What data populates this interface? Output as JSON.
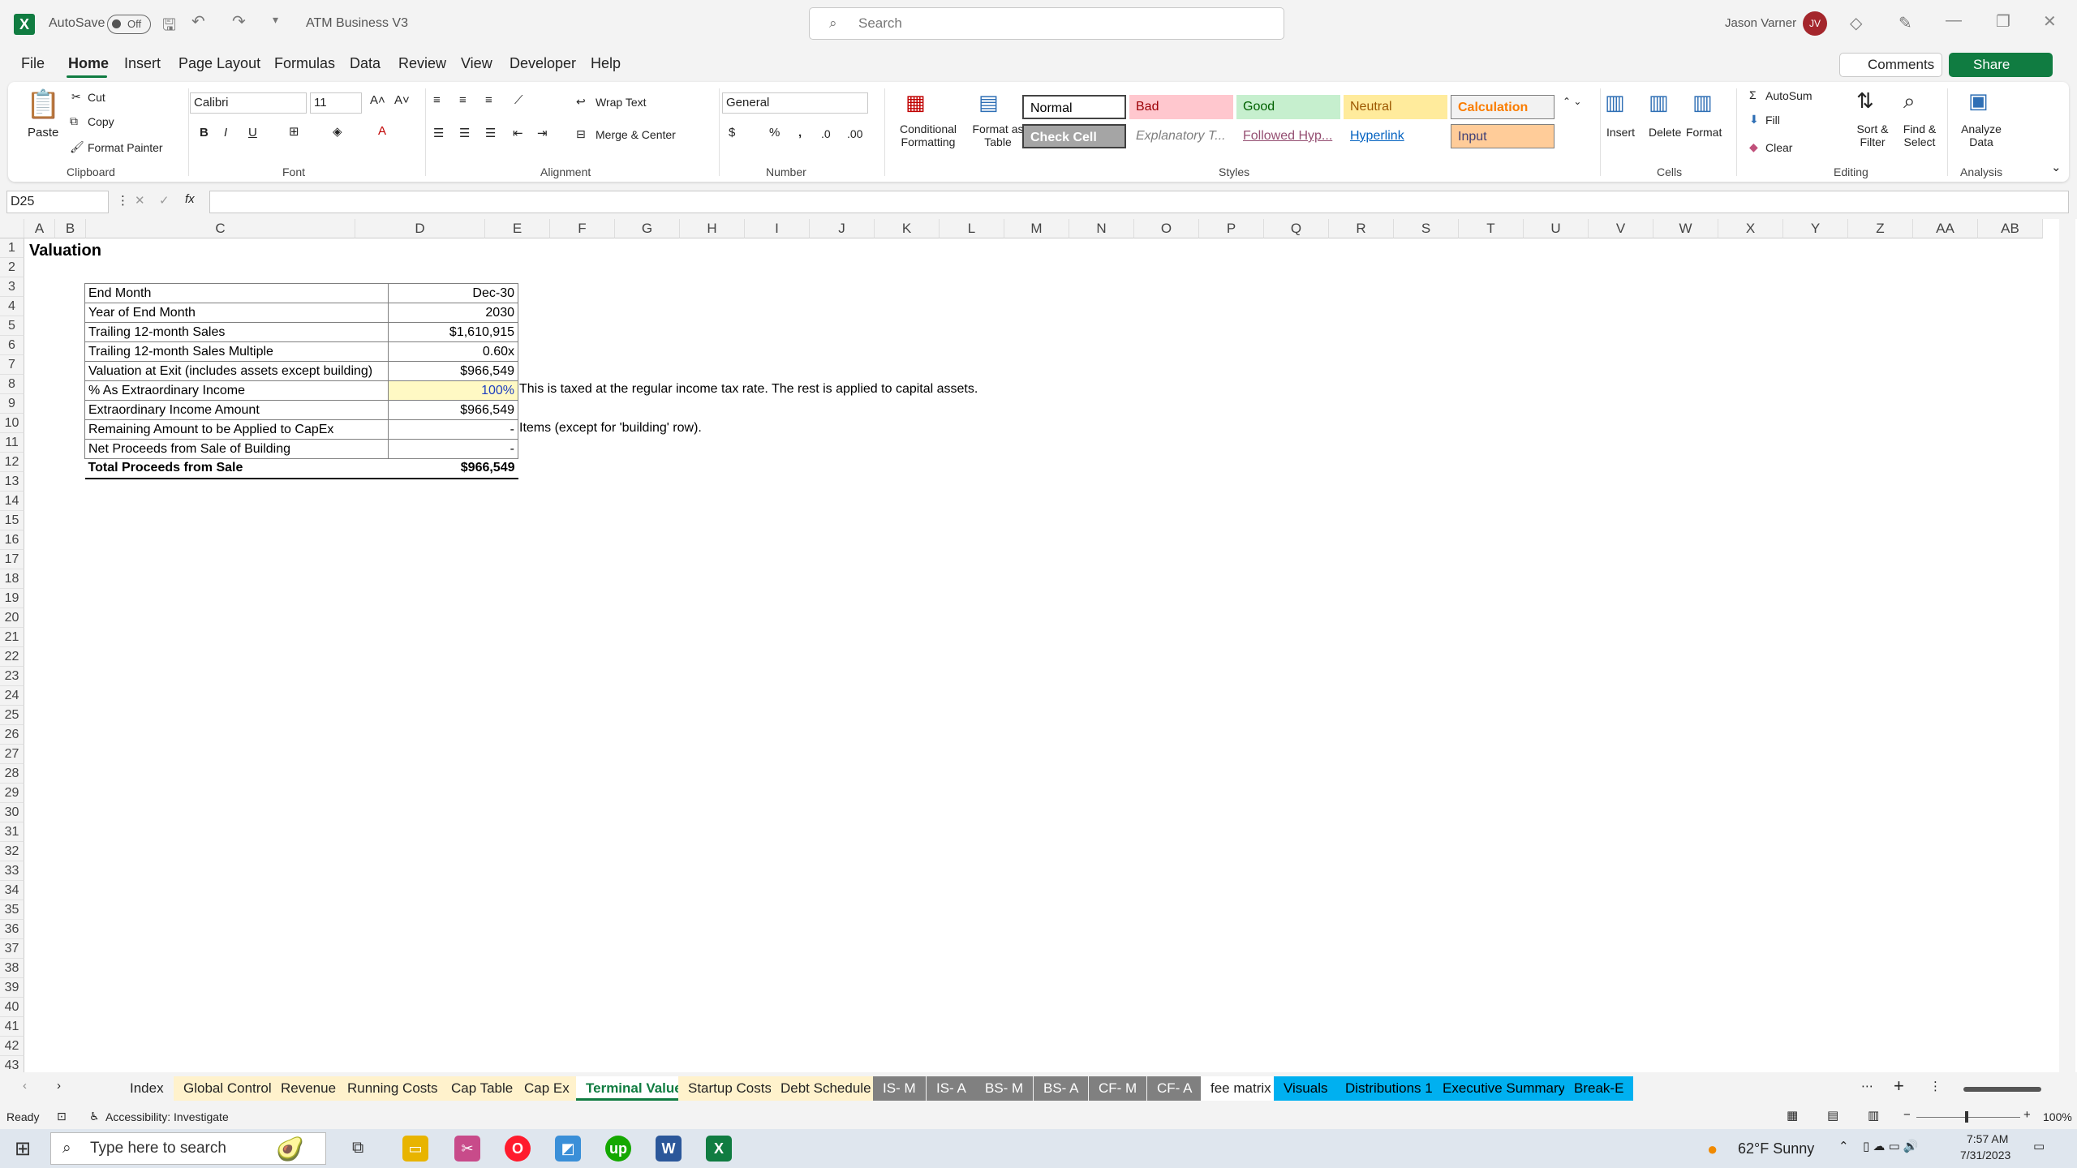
{
  "titlebar": {
    "autosave_label": "AutoSave",
    "autosave_state": "Off",
    "doc_title": "ATM Business V3",
    "search_placeholder": "Search",
    "user_name": "Jason Varner",
    "user_initials": "JV"
  },
  "menu": [
    "File",
    "Home",
    "Insert",
    "Page Layout",
    "Formulas",
    "Data",
    "Review",
    "View",
    "Developer",
    "Help"
  ],
  "buttons": {
    "comments": "Comments",
    "share": "Share"
  },
  "ribbon": {
    "clipboard": {
      "paste": "Paste",
      "cut": "Cut",
      "copy": "Copy",
      "format_painter": "Format Painter",
      "label": "Clipboard"
    },
    "font": {
      "name": "Calibri",
      "size": "11",
      "label": "Font"
    },
    "alignment": {
      "wrap": "Wrap Text",
      "merge": "Merge & Center",
      "label": "Alignment"
    },
    "number": {
      "format": "General",
      "label": "Number"
    },
    "styles": {
      "conditional": "Conditional Formatting",
      "format_table": "Format as Table",
      "cells": [
        {
          "name": "Normal",
          "bg": "#ffffff",
          "fg": "#000000"
        },
        {
          "name": "Bad",
          "bg": "#ffc7ce",
          "fg": "#9c0006"
        },
        {
          "name": "Good",
          "bg": "#c6efce",
          "fg": "#006100"
        },
        {
          "name": "Neutral",
          "bg": "#ffeb9c",
          "fg": "#9c5700"
        },
        {
          "name": "Calculation",
          "bg": "#f2f2f2",
          "fg": "#fa7d00"
        },
        {
          "name": "Check Cell",
          "bg": "#a5a5a5",
          "fg": "#ffffff"
        },
        {
          "name": "Explanatory T...",
          "bg": "#ffffff",
          "fg": "#7f7f7f"
        },
        {
          "name": "Followed Hyp...",
          "bg": "#ffffff",
          "fg": "#954f72"
        },
        {
          "name": "Hyperlink",
          "bg": "#ffffff",
          "fg": "#0563c1"
        },
        {
          "name": "Input",
          "bg": "#ffcc99",
          "fg": "#3f3f76"
        }
      ],
      "label": "Styles"
    },
    "cells_group": {
      "insert": "Insert",
      "delete": "Delete",
      "format": "Format",
      "label": "Cells"
    },
    "editing": {
      "autosum": "AutoSum",
      "fill": "Fill",
      "clear": "Clear",
      "sort": "Sort & Filter",
      "find": "Find & Select",
      "label": "Editing"
    },
    "analysis": {
      "analyze": "Analyze Data",
      "label": "Analysis"
    }
  },
  "formula": {
    "namebox": "D25",
    "fx": "fx",
    "content": ""
  },
  "columns": [
    "A",
    "B",
    "C",
    "D",
    "E",
    "F",
    "G",
    "H",
    "I",
    "J",
    "K",
    "L",
    "M",
    "N",
    "O",
    "P",
    "Q",
    "R",
    "S",
    "T",
    "U",
    "V",
    "W",
    "X",
    "Y",
    "Z",
    "AA",
    "AB"
  ],
  "sheet": {
    "title": "Valuation",
    "rows": [
      {
        "label": "End Month",
        "value": "Dec-30"
      },
      {
        "label": "Year of End Month",
        "value": "2030"
      },
      {
        "label": "Trailing 12-month Sales",
        "value": "$1,610,915"
      },
      {
        "label": "Trailing 12-month Sales Multiple",
        "value": "0.60x"
      },
      {
        "label": "Valuation at Exit (includes assets except building)",
        "value": "$966,549"
      },
      {
        "label": "% As Extraordinary Income",
        "value": "100%"
      },
      {
        "label": "Extraordinary Income Amount",
        "value": "$966,549"
      },
      {
        "label": "Remaining Amount to be Applied to CapEx",
        "value": "-"
      },
      {
        "label": "Net Proceeds from Sale of Building",
        "value": "-"
      },
      {
        "label": "Total Proceeds from Sale",
        "value": "$966,549"
      }
    ],
    "note_row8": "This is taxed at the regular income tax rate. The rest is applied to capital assets.",
    "note_row10": "Items (except for 'building' row)."
  },
  "tabs": [
    {
      "name": "Index",
      "bg": "#f3f3f3",
      "fg": "#242424"
    },
    {
      "name": "Global Control",
      "bg": "#fff2cc",
      "fg": "#242424"
    },
    {
      "name": "Revenue",
      "bg": "#fff2cc",
      "fg": "#242424"
    },
    {
      "name": "Running Costs",
      "bg": "#fff2cc",
      "fg": "#242424"
    },
    {
      "name": "Cap Table",
      "bg": "#fff2cc",
      "fg": "#242424"
    },
    {
      "name": "Cap Ex",
      "bg": "#fff2cc",
      "fg": "#242424"
    },
    {
      "name": "Terminal Value",
      "bg": "#ffffff",
      "fg": "#107c41"
    },
    {
      "name": "Startup Costs",
      "bg": "#fff2cc",
      "fg": "#242424"
    },
    {
      "name": "Debt Schedule",
      "bg": "#fff2cc",
      "fg": "#242424"
    },
    {
      "name": "IS- M",
      "bg": "#808080",
      "fg": "#ffffff"
    },
    {
      "name": "IS- A",
      "bg": "#808080",
      "fg": "#ffffff"
    },
    {
      "name": "BS- M",
      "bg": "#808080",
      "fg": "#ffffff"
    },
    {
      "name": "BS- A",
      "bg": "#808080",
      "fg": "#ffffff"
    },
    {
      "name": "CF- M",
      "bg": "#808080",
      "fg": "#ffffff"
    },
    {
      "name": "CF- A",
      "bg": "#808080",
      "fg": "#ffffff"
    },
    {
      "name": "fee matrix",
      "bg": "#ffffff",
      "fg": "#242424"
    },
    {
      "name": "Visuals",
      "bg": "#00b0f0",
      "fg": "#000000"
    },
    {
      "name": "Distributions 1",
      "bg": "#00b0f0",
      "fg": "#000000"
    },
    {
      "name": "Executive Summary",
      "bg": "#00b0f0",
      "fg": "#000000"
    },
    {
      "name": "Break-E",
      "bg": "#00b0f0",
      "fg": "#000000"
    }
  ],
  "status": {
    "ready": "Ready",
    "accessibility": "Accessibility: Investigate",
    "zoom": "100%"
  },
  "taskbar": {
    "search_placeholder": "Type here to search",
    "weather": "62°F  Sunny",
    "time": "7:57 AM",
    "date": "7/31/2023"
  }
}
